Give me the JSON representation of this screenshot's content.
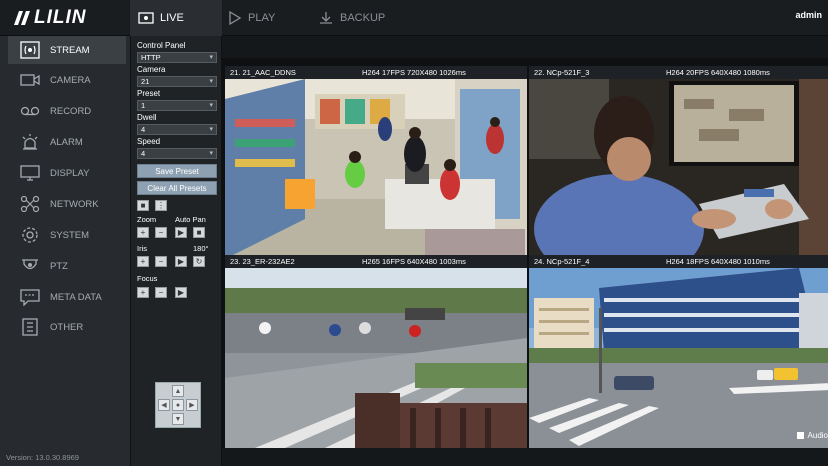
{
  "app": {
    "logo_text": "LILIN",
    "user": "admin",
    "version": "Version: 13.0.30.8969"
  },
  "tabs": [
    {
      "label": "LIVE",
      "icon": "live-view-icon",
      "active": true
    },
    {
      "label": "PLAY",
      "icon": "play-icon",
      "active": false
    },
    {
      "label": "BACKUP",
      "icon": "download-icon",
      "active": false
    }
  ],
  "sidebar": {
    "items": [
      {
        "label": "STREAM",
        "icon": "stream-icon",
        "active": true
      },
      {
        "label": "CAMERA",
        "icon": "camera-icon",
        "active": false
      },
      {
        "label": "RECORD",
        "icon": "record-tape-icon",
        "active": false
      },
      {
        "label": "ALARM",
        "icon": "alarm-siren-icon",
        "active": false
      },
      {
        "label": "DISPLAY",
        "icon": "monitor-icon",
        "active": false
      },
      {
        "label": "NETWORK",
        "icon": "network-icon",
        "active": false
      },
      {
        "label": "SYSTEM",
        "icon": "gear-icon",
        "active": false
      },
      {
        "label": "PTZ",
        "icon": "ptz-dome-icon",
        "active": false
      },
      {
        "label": "META DATA",
        "icon": "metadata-icon",
        "active": false
      },
      {
        "label": "OTHER",
        "icon": "document-icon",
        "active": false
      }
    ]
  },
  "control_panel": {
    "title": "Control Panel",
    "protocol": "HTTP",
    "camera_label": "Camera",
    "camera_value": "21",
    "preset_label": "Preset",
    "preset_value": "1",
    "dwell_label": "Dwell",
    "dwell_value": "4",
    "speed_label": "Speed",
    "speed_value": "4",
    "save_preset": "Save Preset",
    "clear_presets": "Clear All Presets",
    "zoom_label": "Zoom",
    "auto_pan_label": "Auto Pan",
    "iris_label": "Iris",
    "iris_angle": "180°",
    "focus_label": "Focus"
  },
  "cameras": [
    {
      "name": "21. 21_AAC_DDNS",
      "spec": "H264 17FPS 720X480 1026ms"
    },
    {
      "name": "22. NCp-521F_3",
      "spec": "H264 20FPS 640X480 1080ms"
    },
    {
      "name": "23. 23_ER-232AE2",
      "spec": "H265 16FPS 640X480 1003ms"
    },
    {
      "name": "24. NCp-521F_4",
      "spec": "H264 18FPS 640X480 1010ms"
    }
  ],
  "audio_label": "Audio",
  "colors": {
    "active_tab": "#2a2e32",
    "sidebar": "#272b2f",
    "button": "#8ea1b2"
  }
}
